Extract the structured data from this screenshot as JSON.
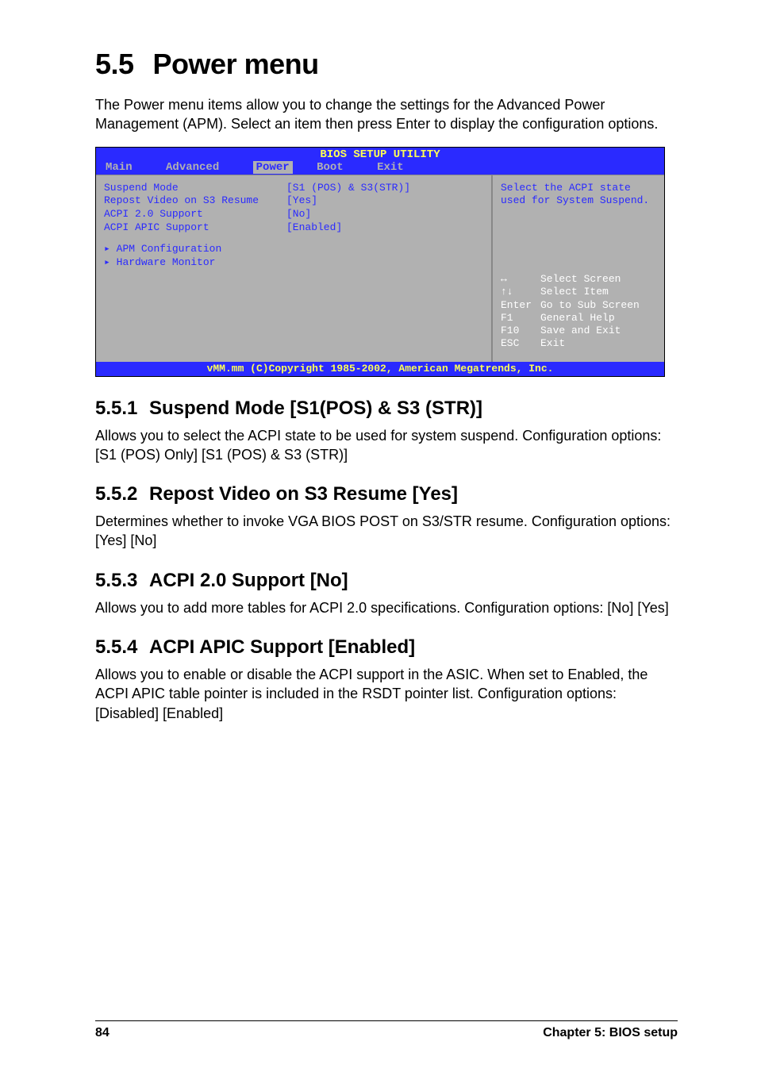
{
  "section": {
    "number": "5.5",
    "title": "Power menu",
    "intro": "The Power menu items allow you to change the settings for the Advanced Power Management (APM). Select an item then press Enter to display the configuration options."
  },
  "bios": {
    "title": "BIOS SETUP UTILITY",
    "tabs": [
      "Main",
      "Advanced",
      "Power",
      "Boot",
      "Exit"
    ],
    "active_tab": "Power",
    "rows": [
      {
        "label": "Suspend Mode",
        "value": "[S1 (POS) & S3(STR)]"
      },
      {
        "label": "Repost Video on S3 Resume",
        "value": "[Yes]"
      },
      {
        "label": "ACPI 2.0 Support",
        "value": "[No]"
      },
      {
        "label": "ACPI APIC Support",
        "value": "[Enabled]"
      }
    ],
    "subs": [
      "APM Configuration",
      "Hardware Monitor"
    ],
    "help_top": "Select the ACPI state used for System Suspend.",
    "hotkeys": [
      {
        "key": "↔",
        "desc": "Select Screen"
      },
      {
        "key": "↑↓",
        "desc": "Select Item"
      },
      {
        "key": "Enter",
        "desc": "Go to Sub Screen"
      },
      {
        "key": "F1",
        "desc": "General Help"
      },
      {
        "key": "F10",
        "desc": "Save and Exit"
      },
      {
        "key": "ESC",
        "desc": "Exit"
      }
    ],
    "footer": "vMM.mm (C)Copyright 1985-2002, American Megatrends, Inc."
  },
  "subsections": [
    {
      "num": "5.5.1",
      "title": "Suspend Mode [S1(POS) & S3 (STR)]",
      "body": "Allows you to select the ACPI state to be used for system suspend. Configuration options: [S1 (POS) Only] [S1 (POS) & S3 (STR)]"
    },
    {
      "num": "5.5.2",
      "title": "Repost Video on S3 Resume [Yes]",
      "body": "Determines whether to invoke VGA BIOS POST on S3/STR resume. Configuration options: [Yes] [No]"
    },
    {
      "num": "5.5.3",
      "title": "ACPI 2.0 Support [No]",
      "body": "Allows you to add more tables for ACPI 2.0 specifications. Configuration options: [No] [Yes]"
    },
    {
      "num": "5.5.4",
      "title": "ACPI APIC Support [Enabled]",
      "body": "Allows you to enable or disable the ACPI support in the ASIC. When set to Enabled, the ACPI APIC table pointer is included in the RSDT pointer list. Configuration options: [Disabled] [Enabled]"
    }
  ],
  "footer": {
    "page": "84",
    "title": "Chapter 5: BIOS setup"
  }
}
